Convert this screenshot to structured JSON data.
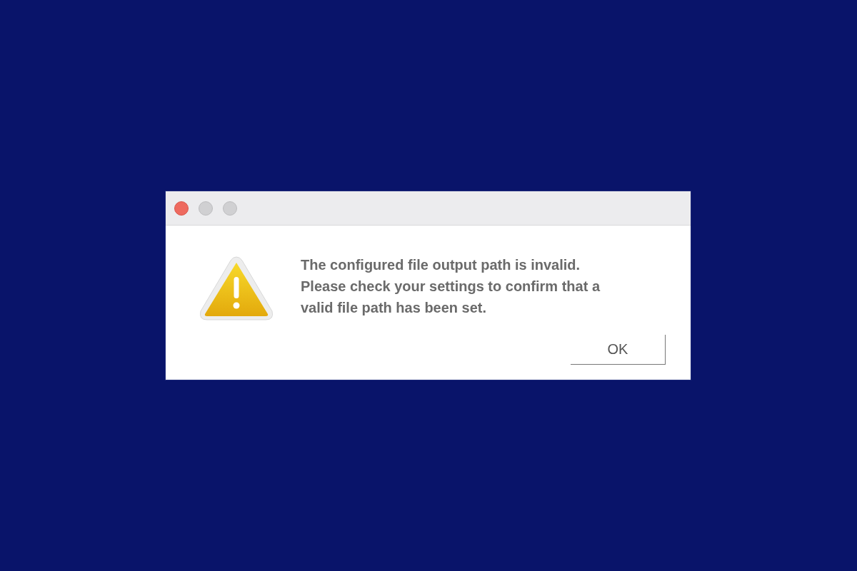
{
  "window": {
    "controls": [
      {
        "kind": "close",
        "active": true
      },
      {
        "kind": "minimize",
        "active": false
      },
      {
        "kind": "zoom",
        "active": false
      }
    ]
  },
  "message": {
    "lines": [
      "The configured file output path is invalid.",
      "Please check your settings to confirm that a",
      "valid file path has been set."
    ]
  },
  "buttons": [
    "OK"
  ]
}
